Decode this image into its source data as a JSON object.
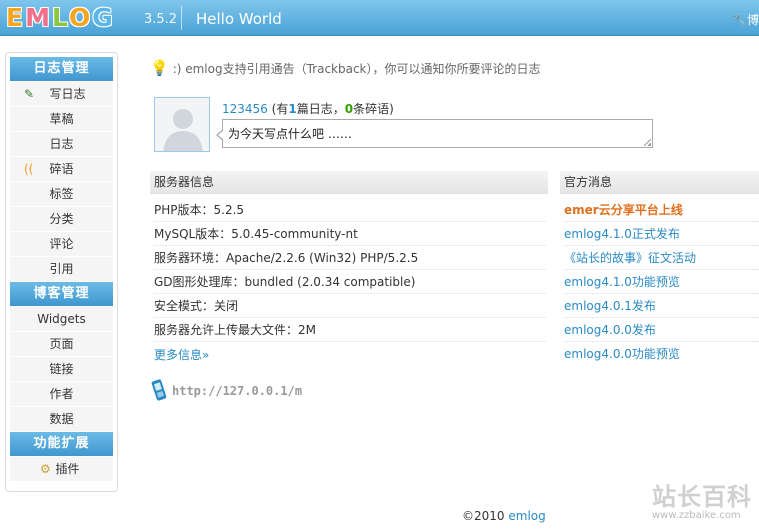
{
  "header": {
    "logo": "EMLOG",
    "version": "3.5.2",
    "site_name": "Hello World",
    "right_text": "博"
  },
  "sidebar": {
    "groups": [
      {
        "title": "日志管理",
        "items": [
          "写日志",
          "草稿",
          "日志",
          "碎语",
          "标签",
          "分类",
          "评论",
          "引用"
        ]
      },
      {
        "title": "博客管理",
        "items": [
          "Widgets",
          "页面",
          "链接",
          "作者",
          "数据"
        ]
      },
      {
        "title": "功能扩展",
        "items": [
          "插件"
        ]
      }
    ]
  },
  "tip": ":) emlog支持引用通告（Trackback），你可以通知你所要评论的日志",
  "user": {
    "name": "123456",
    "prefix": "(有",
    "posts": "1",
    "posts_label": "篇日志，",
    "twitters": "0",
    "twitters_label": "条碎语)",
    "status_text": "为今天写点什么吧 ……"
  },
  "server": {
    "title": "服务器信息",
    "rows": [
      "PHP版本：5.2.5",
      "MySQL版本：5.0.45-community-nt",
      "服务器环境：Apache/2.2.6 (Win32) PHP/5.2.5",
      "GD图形处理库：bundled (2.0.34 compatible)",
      "安全模式：关闭",
      "服务器允许上传最大文件：2M"
    ],
    "more": "更多信息»"
  },
  "news": {
    "title": "官方消息",
    "items": [
      "emer云分享平台上线",
      "emlog4.1.0正式发布",
      "《站长的故事》征文活动",
      "emlog4.1.0功能预览",
      "emlog4.0.1发布",
      "emlog4.0.0发布",
      "emlog4.0.0功能预览"
    ]
  },
  "mobile_url": "http://127.0.0.1/m",
  "footer": {
    "copyright": "©2010",
    "link": "emlog"
  },
  "watermark": {
    "big": "站长百科",
    "small": "www.zzbaike.com"
  },
  "colors": {
    "header": "#4aa3d6",
    "accent_link": "#2a8ac6",
    "hot": "#e0701e",
    "count_green": "#33a000"
  }
}
